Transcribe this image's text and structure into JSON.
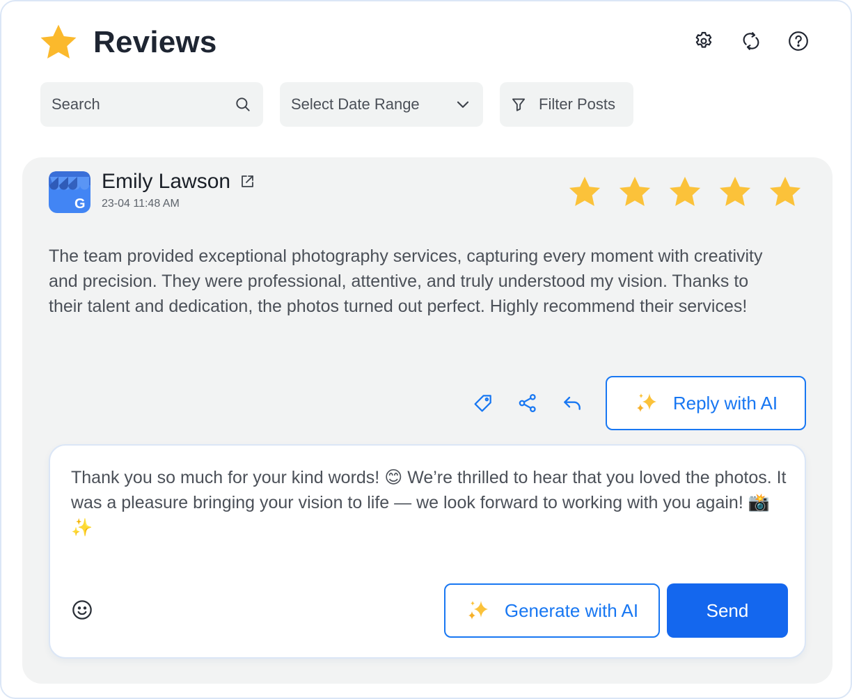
{
  "header": {
    "title": "Reviews",
    "logo_icon": "star-icon",
    "actions": [
      "gear-icon",
      "refresh-icon",
      "help-icon"
    ]
  },
  "toolbar": {
    "search_placeholder": "Search",
    "date_range_label": "Select Date Range",
    "filter_label": "Filter Posts"
  },
  "review": {
    "source_icon": "google-business-icon",
    "reviewer_name": "Emily Lawson",
    "date": "23-04 11:48 AM",
    "rating": 5,
    "rating_max": 5,
    "text": "The team provided exceptional photography services, capturing every moment with creativity and precision. They were professional, attentive, and truly understood my vision. Thanks to their talent and dedication, the photos turned out perfect. Highly recommend their services!",
    "reply_with_ai_label": "Reply with AI"
  },
  "reply": {
    "text": "Thank you so much for your kind words! 😊 We’re thrilled to hear that you loved the photos. It was a pleasure bringing your vision to life — we look forward to working with you again! 📸✨",
    "generate_label": "Generate with AI",
    "send_label": "Send"
  },
  "colors": {
    "accent": "#1877f2",
    "send_bg": "#1467ee",
    "star": "#fbc23a",
    "card_bg": "#f2f3f3"
  }
}
